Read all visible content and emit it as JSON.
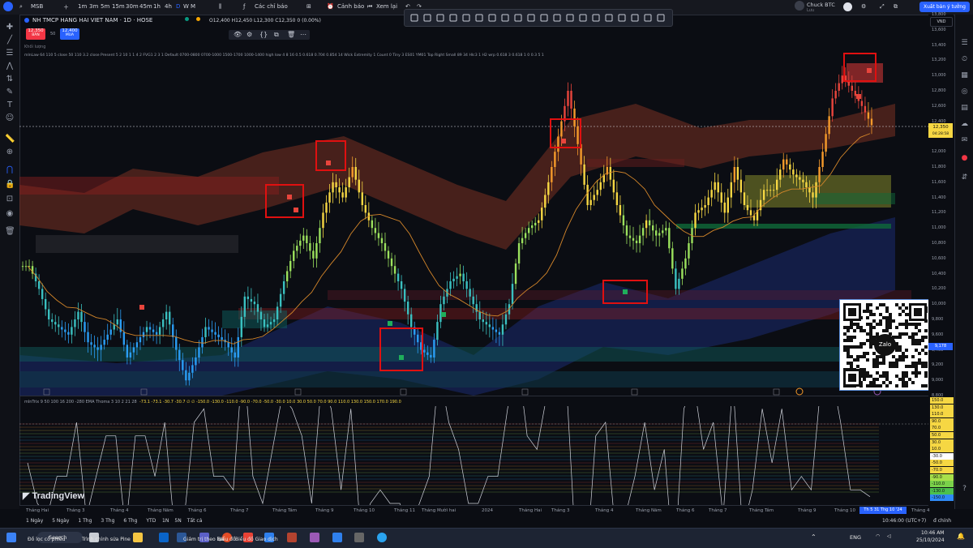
{
  "topbar": {
    "symbol_search": "MSB",
    "intervals": [
      "1m",
      "3m",
      "5m",
      "15m",
      "30m",
      "45m",
      "1h",
      "4h",
      "D",
      "W",
      "M"
    ],
    "active_interval": "D",
    "indicators_label": "Các chỉ báo",
    "alert_label": "Cảnh báo",
    "replay_label": "Xem lại",
    "layout_name": "Chuck BTC",
    "layout_sub": "Lưu",
    "publish_label": "Xuất bản ý tưởng"
  },
  "legend": {
    "title": "NH TMCP HANG HAI VIET NAM · 1D · HOSE",
    "ohlc": "O12,400 H12,450 L12,300 C12,350 0 (0.00%)",
    "sell_price": "12,350",
    "sell_label": "BÁN",
    "spread": "50",
    "buy_price": "12,400",
    "buy_label": "MUA",
    "volume_label": "Khối lượng",
    "indicator_line": "mlnLaw 64 110 5 close 50 110 3.2 close Present 5 2 10 1 1 4 2 FVG1 2 3 1 Default 0700-0800 0700-1000 1500-1700 1000-1400 high low 4 8 16 0.5 0.618 0.704 0.854 14 Wick Extremity 1 Count 0 Tiny 3 ES01 YM01 Top Right Small 89 34 Hlc3 1 H2 wrp 0.618 3 0.618 1 0 0.3 5 1",
    "osc_line": "mlnTrix 9 50 100 16 200 -280 EMA Thoma 3 10 2 21 28",
    "osc_values": "-73.1  -73.1  -30.7  -30.7  ∅ ∅  -150.0 -130.0 -110.0 -90.0 -70.0 -50.0 -30.0 10.0 30.0 50.0 70.0 90.0 110.0 130.0 150.0 170.0 190.0"
  },
  "price_axis": {
    "currency": "VND",
    "ticks": [
      "13,800",
      "13,600",
      "13,400",
      "13,200",
      "13,000",
      "12,800",
      "12,600",
      "12,400",
      "12,200",
      "12,000",
      "11,800",
      "11,600",
      "11,400",
      "11,200",
      "11,000",
      "10,800",
      "10,600",
      "10,400",
      "10,200",
      "10,000",
      "9,800",
      "9,600",
      "9,400",
      "9,200",
      "9,000",
      "8,800"
    ],
    "last_price": "12,350",
    "countdown": "04:28:58",
    "mark": "9,178"
  },
  "osc_axis": {
    "ticks": [
      "150.0",
      "130.0",
      "110.0",
      "90.0",
      "70.0",
      "50.0",
      "30.0",
      "10.0",
      "-30.0",
      "-50.0",
      "-70.0",
      "-90.0",
      "-110.0",
      "-130.0",
      "-150.0"
    ],
    "tick_colors": [
      "#f6d743",
      "#f6d743",
      "#f6d743",
      "#f6d743",
      "#f6d743",
      "#f6d743",
      "#f6d743",
      "#f6d743",
      "#ffffff",
      "#f6d743",
      "#f6d743",
      "#a7e04a",
      "#7ad14a",
      "#4cc04c",
      "#2f8af5"
    ]
  },
  "time_axis": {
    "labels": [
      "Tháng Hai",
      "Tháng 3",
      "Tháng 4",
      "Tháng Năm",
      "Tháng 6",
      "Tháng 7",
      "Tháng Tám",
      "Tháng 9",
      "Tháng 10",
      "Tháng 11",
      "Tháng Mười hai",
      "2024",
      "Tháng Hai",
      "Tháng 3",
      "Tháng 4",
      "Tháng Năm",
      "Tháng 6",
      "Tháng 7",
      "Tháng Tám",
      "Tháng 9",
      "Tháng 10",
      "Tháng 4"
    ],
    "current": "Th 5 31 Thg 10 '24"
  },
  "range_bar": {
    "ranges": [
      "1 Ngày",
      "5 Ngày",
      "1 Thg",
      "3 Thg",
      "6 Thg",
      "YTD",
      "1N",
      "5N",
      "Tất cả"
    ],
    "time": "10:46:00 (UTC+7)",
    "adj": "đ chính"
  },
  "watermark": "TradingView",
  "zalo_label": "Zalo",
  "taskbar": {
    "search": "Search",
    "items": [
      "Đồ lọc cổ phiếu",
      "Trình chỉnh sửa Pine",
      "Giám trị theo lựa",
      "Biểu đồ",
      "Biểu đồ Giao dịch",
      "Google Chrome",
      "Telegram"
    ],
    "lang": "ENG",
    "clock": "10:46 AM",
    "date": "25/10/2024"
  },
  "chart_data": {
    "type": "candlestick",
    "title": "NH TMCP HANG HAI VIET NAM · 1D · HOSE",
    "ylim": [
      8800,
      13800
    ],
    "close_series": [
      10500,
      10200,
      9800,
      9700,
      9600,
      9900,
      9500,
      9400,
      9600,
      9800,
      9300,
      9500,
      9700,
      9600,
      9900,
      9400,
      9000,
      9300,
      9700,
      9600,
      9500,
      9300,
      10100,
      10000,
      9700,
      9800,
      10300,
      10700,
      10900,
      10600,
      11200,
      11600,
      11400,
      11800,
      11300,
      11000,
      10800,
      10500,
      10200,
      9700,
      9400,
      9300,
      10000,
      10300,
      10400,
      10100,
      9800,
      9700,
      9600,
      10000,
      10800,
      11000,
      11100,
      11600,
      12200,
      12800,
      12100,
      11300,
      11500,
      11800,
      11300,
      10900,
      10800,
      11100,
      10900,
      11000,
      10200,
      10600,
      11200,
      11300,
      11600,
      11200,
      11800,
      11300,
      11100,
      11500,
      11500,
      11900,
      11700,
      11600,
      11400,
      12000,
      12700,
      13000,
      12800,
      12600,
      12350
    ],
    "last": 12350
  }
}
